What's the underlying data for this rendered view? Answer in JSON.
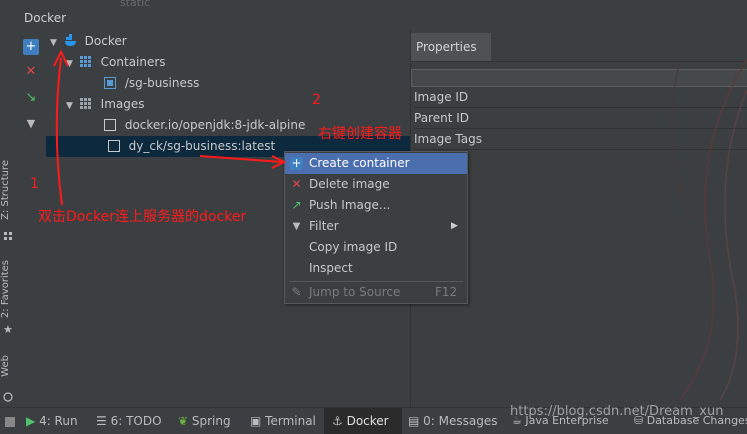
{
  "window": {
    "title": "Docker",
    "bg_ghost_text": "static"
  },
  "left_vtabs": [
    "Z: Structure",
    "2: Favorites",
    "Web"
  ],
  "toolbar": {
    "add_label": "+",
    "remove_label": "✕",
    "expand_label": "↘",
    "filter_label": "▼"
  },
  "tree": {
    "root": "Docker",
    "containers_group": "Containers",
    "container_item": "/sg-business",
    "images_group": "Images",
    "image_1": "docker.io/openjdk:8-jdk-alpine",
    "image_2": "dy_ck/sg-business:latest"
  },
  "properties": {
    "tab": "Properties",
    "rows": [
      "Image ID",
      "Parent ID",
      "Image Tags"
    ]
  },
  "context_menu": {
    "items": [
      {
        "label": "Create container",
        "icon": "plus-icon"
      },
      {
        "label": "Delete image",
        "icon": "delete-icon"
      },
      {
        "label": "Push Image...",
        "icon": "push-icon"
      },
      {
        "label": "Filter",
        "icon": "filter-icon",
        "submenu": true
      },
      {
        "label": "Copy image ID"
      },
      {
        "label": "Inspect"
      }
    ],
    "jump_label": "Jump to Source",
    "jump_shortcut": "F12"
  },
  "annotations": {
    "num1": "1",
    "num2": "2",
    "note1": "双击Docker连上服务器的docker",
    "note2": "右键创建容器"
  },
  "status_tabs": [
    {
      "icon": "run-icon",
      "label": "4: Run"
    },
    {
      "icon": "todo-icon",
      "label": "6: TODO"
    },
    {
      "icon": "spring-icon",
      "label": "Spring"
    },
    {
      "icon": "terminal-icon",
      "label": "Terminal"
    },
    {
      "icon": "docker-icon",
      "label": "Docker"
    },
    {
      "icon": "messages-icon",
      "label": "0: Messages"
    },
    {
      "icon": "java-icon",
      "label": "Java Enterprise"
    },
    {
      "icon": "db-icon",
      "label": "Database Changes"
    }
  ],
  "watermark": "https://blog.csdn.net/Dream_xun",
  "colors": {
    "selection": "#0d293e",
    "menu_highlight": "#4b6eaf",
    "annotation": "#ff1a1a",
    "docker_blue": "#2496ed"
  }
}
